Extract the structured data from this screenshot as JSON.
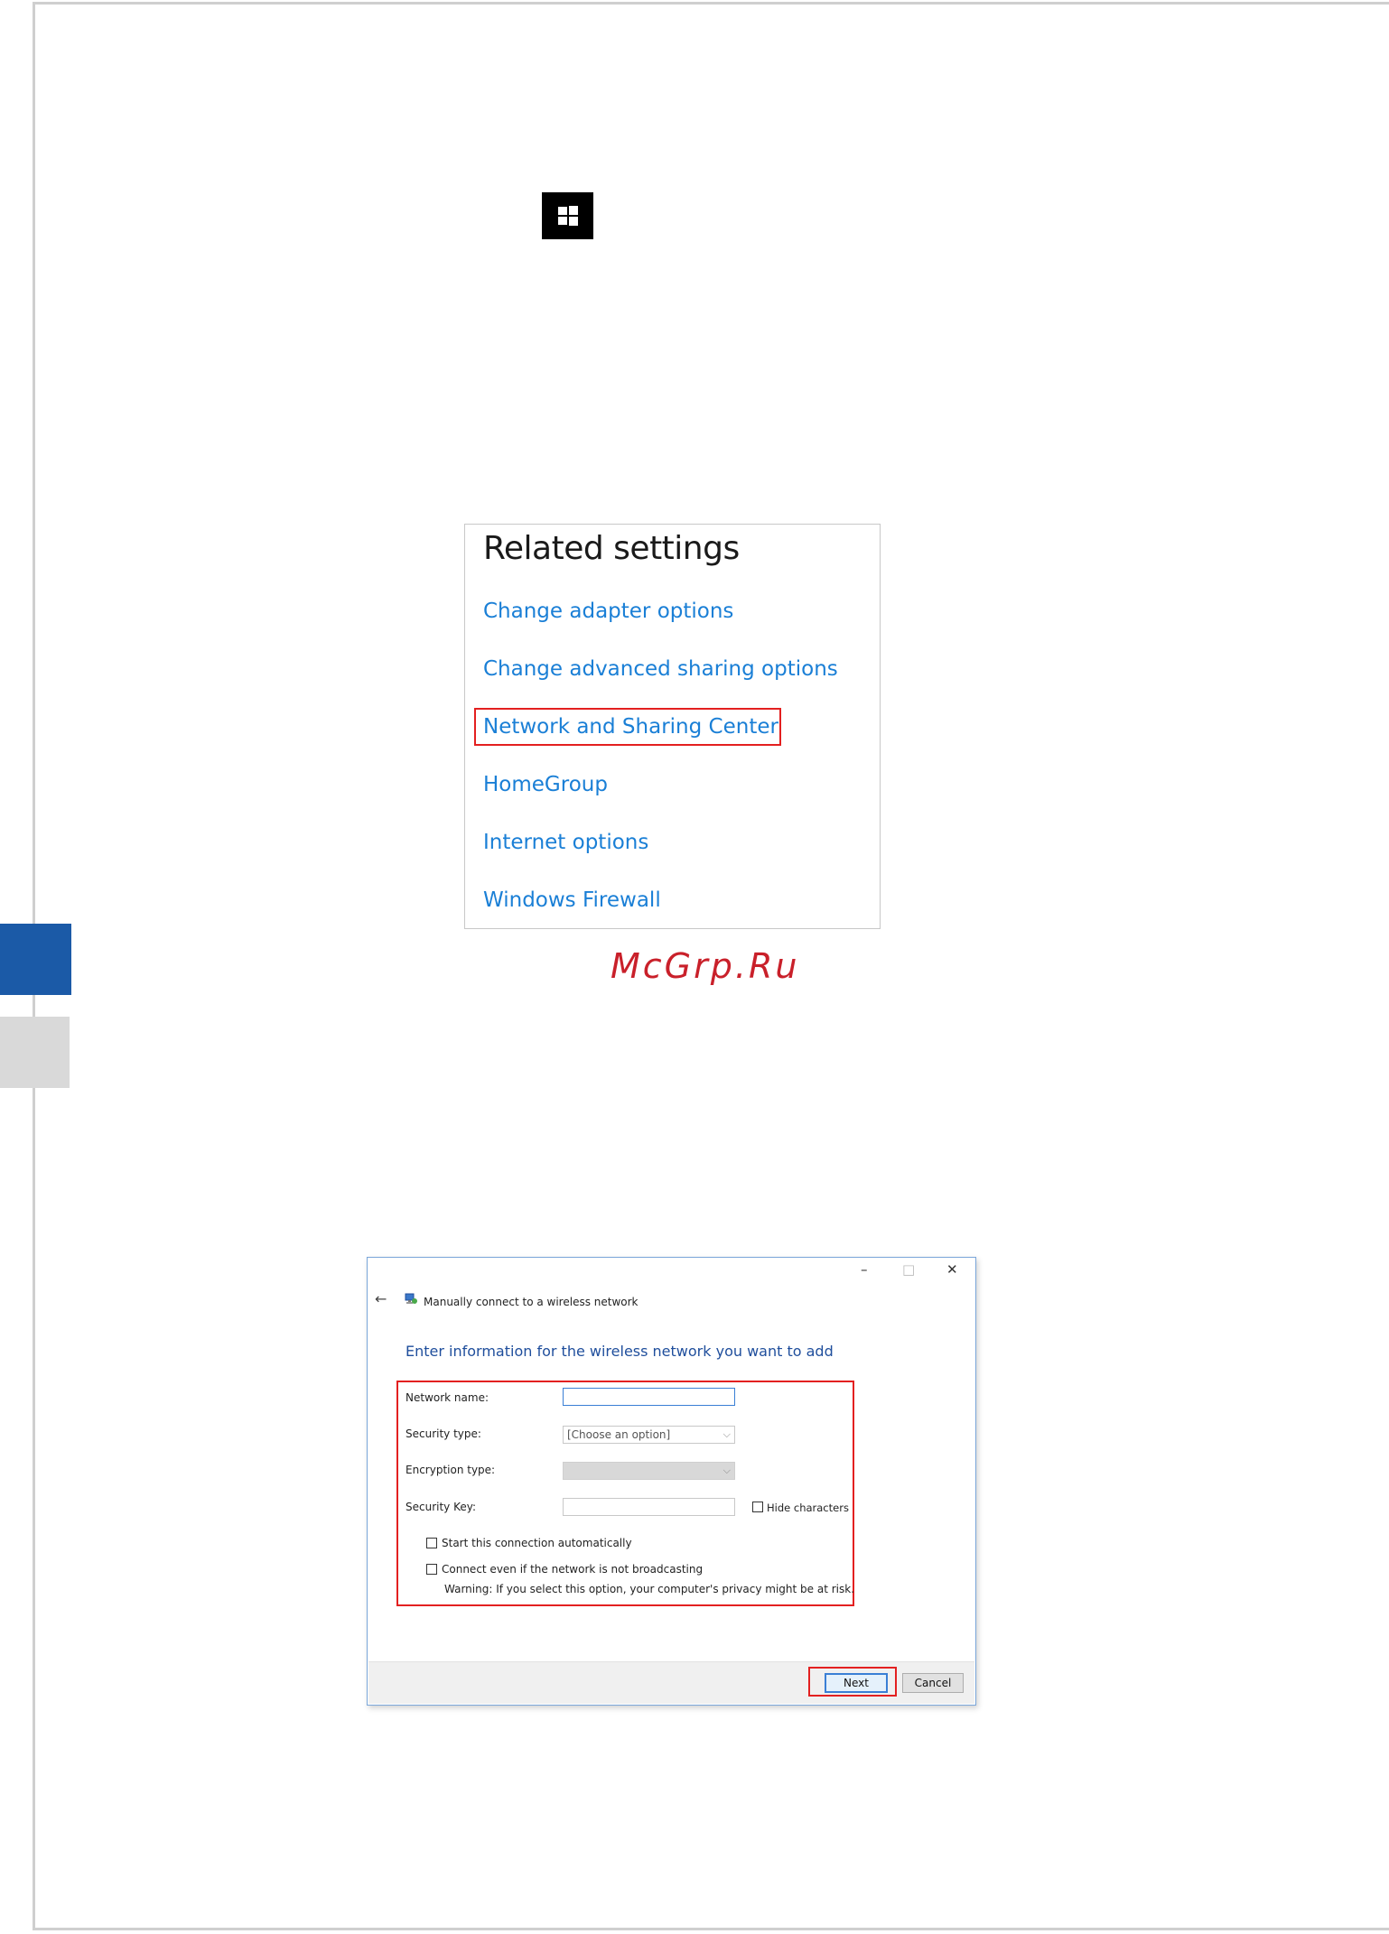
{
  "related_settings": {
    "title": "Related settings",
    "links": [
      "Change adapter options",
      "Change advanced sharing options",
      "Network and Sharing Center",
      "HomeGroup",
      "Internet options",
      "Windows Firewall"
    ],
    "highlighted_link_index": 2
  },
  "watermark": "McGrp.Ru",
  "dialog": {
    "title": "Manually connect to a wireless network",
    "heading": "Enter information for the wireless network you want to add",
    "controls": {
      "minimize": "–",
      "maximize": "□",
      "close": "✕"
    },
    "back_icon": "←",
    "fields": {
      "network_name_label": "Network name:",
      "network_name_value": "",
      "security_type_label": "Security type:",
      "security_type_value": "[Choose an option]",
      "encryption_type_label": "Encryption type:",
      "encryption_type_value": "",
      "security_key_label": "Security Key:",
      "security_key_value": "",
      "hide_characters_label": "Hide characters"
    },
    "checkboxes": {
      "start_auto_label": "Start this connection automatically",
      "connect_not_broadcasting_label": "Connect even if the network is not broadcasting",
      "warning": "Warning: If you select this option, your computer's privacy might be at risk."
    },
    "buttons": {
      "next": "Next",
      "cancel": "Cancel"
    }
  },
  "colors": {
    "link": "#1a7fd6",
    "highlight": "#e32020",
    "side_tab_active": "#1b5aa7",
    "side_tab_inactive": "#d9d9d9",
    "dialog_heading": "#1f4e9c"
  }
}
